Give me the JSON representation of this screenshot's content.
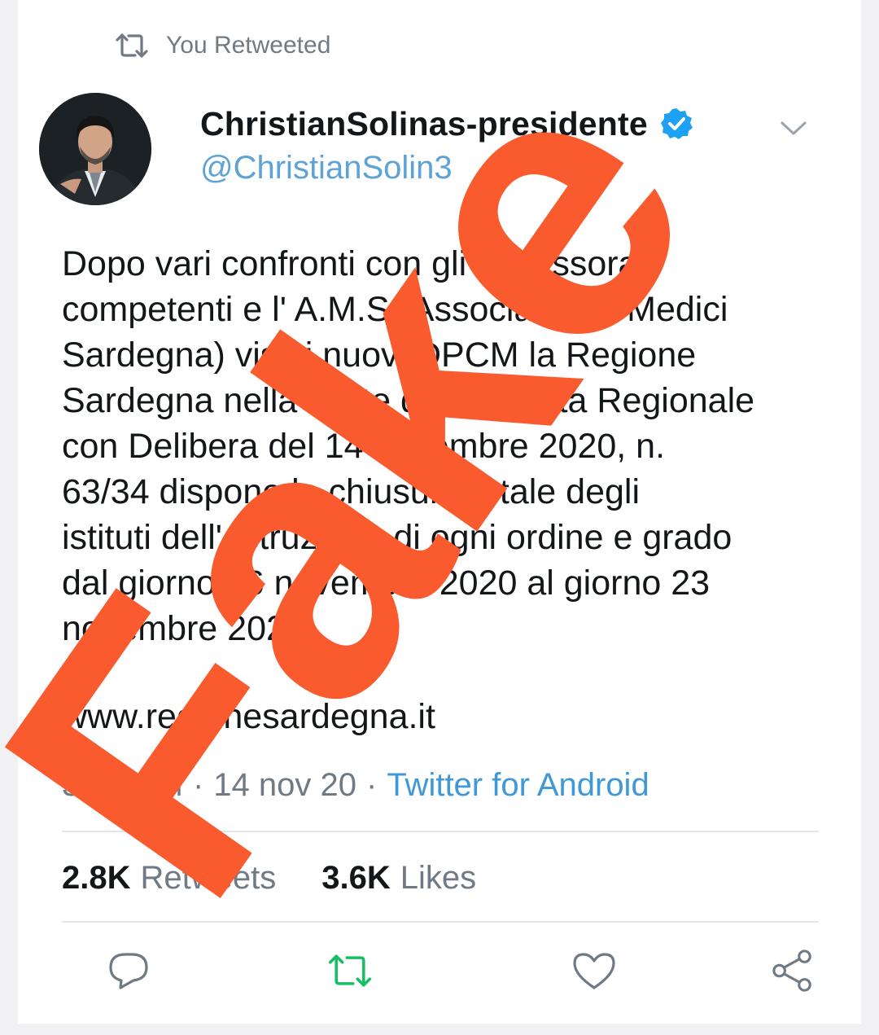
{
  "retweet_banner": {
    "text": "You Retweeted",
    "icon": "retweet-icon"
  },
  "author": {
    "name": "ChristianSolinas-presidente",
    "handle": "@ChristianSolin3",
    "verified": true,
    "avatar": "avatar-photo"
  },
  "tweet": {
    "lines": [
      "Dopo vari confronti con gli Assessorati",
      "competenti e l' A.M.S.(Associazione Medici",
      "Sardegna) visti i nuovi DPCM la Regione",
      "Sardegna nella veste della Giunta Regionale",
      "con Delibera del 14 novembre 2020, n.",
      "63/34 dispone la chiusura totale degli",
      "istituti dell' Istruzione di ogni ordine e grado",
      "dal giorno 16 novembre 2020 al giorno 23",
      "novembre 2020."
    ],
    "url": "www.regionesardegna.it",
    "time": "3:08 PM",
    "date": "14 nov 20",
    "separator": "·",
    "source": "Twitter for Android"
  },
  "stats": {
    "retweets_count": "2.8K",
    "retweets_label": "Retweets",
    "likes_count": "3.6K",
    "likes_label": "Likes"
  },
  "overlay": {
    "stamp_text": "Fake",
    "color": "#f95b2f"
  },
  "colors": {
    "link": "#5ea3d6",
    "source": "#3f98d7",
    "retweet_active": "#17bf63",
    "muted": "#707a85",
    "verified": "#1da1f2"
  },
  "icons": [
    "reply-icon",
    "retweet-icon",
    "like-icon",
    "share-icon",
    "chevron-down-icon",
    "verified-badge-icon"
  ]
}
